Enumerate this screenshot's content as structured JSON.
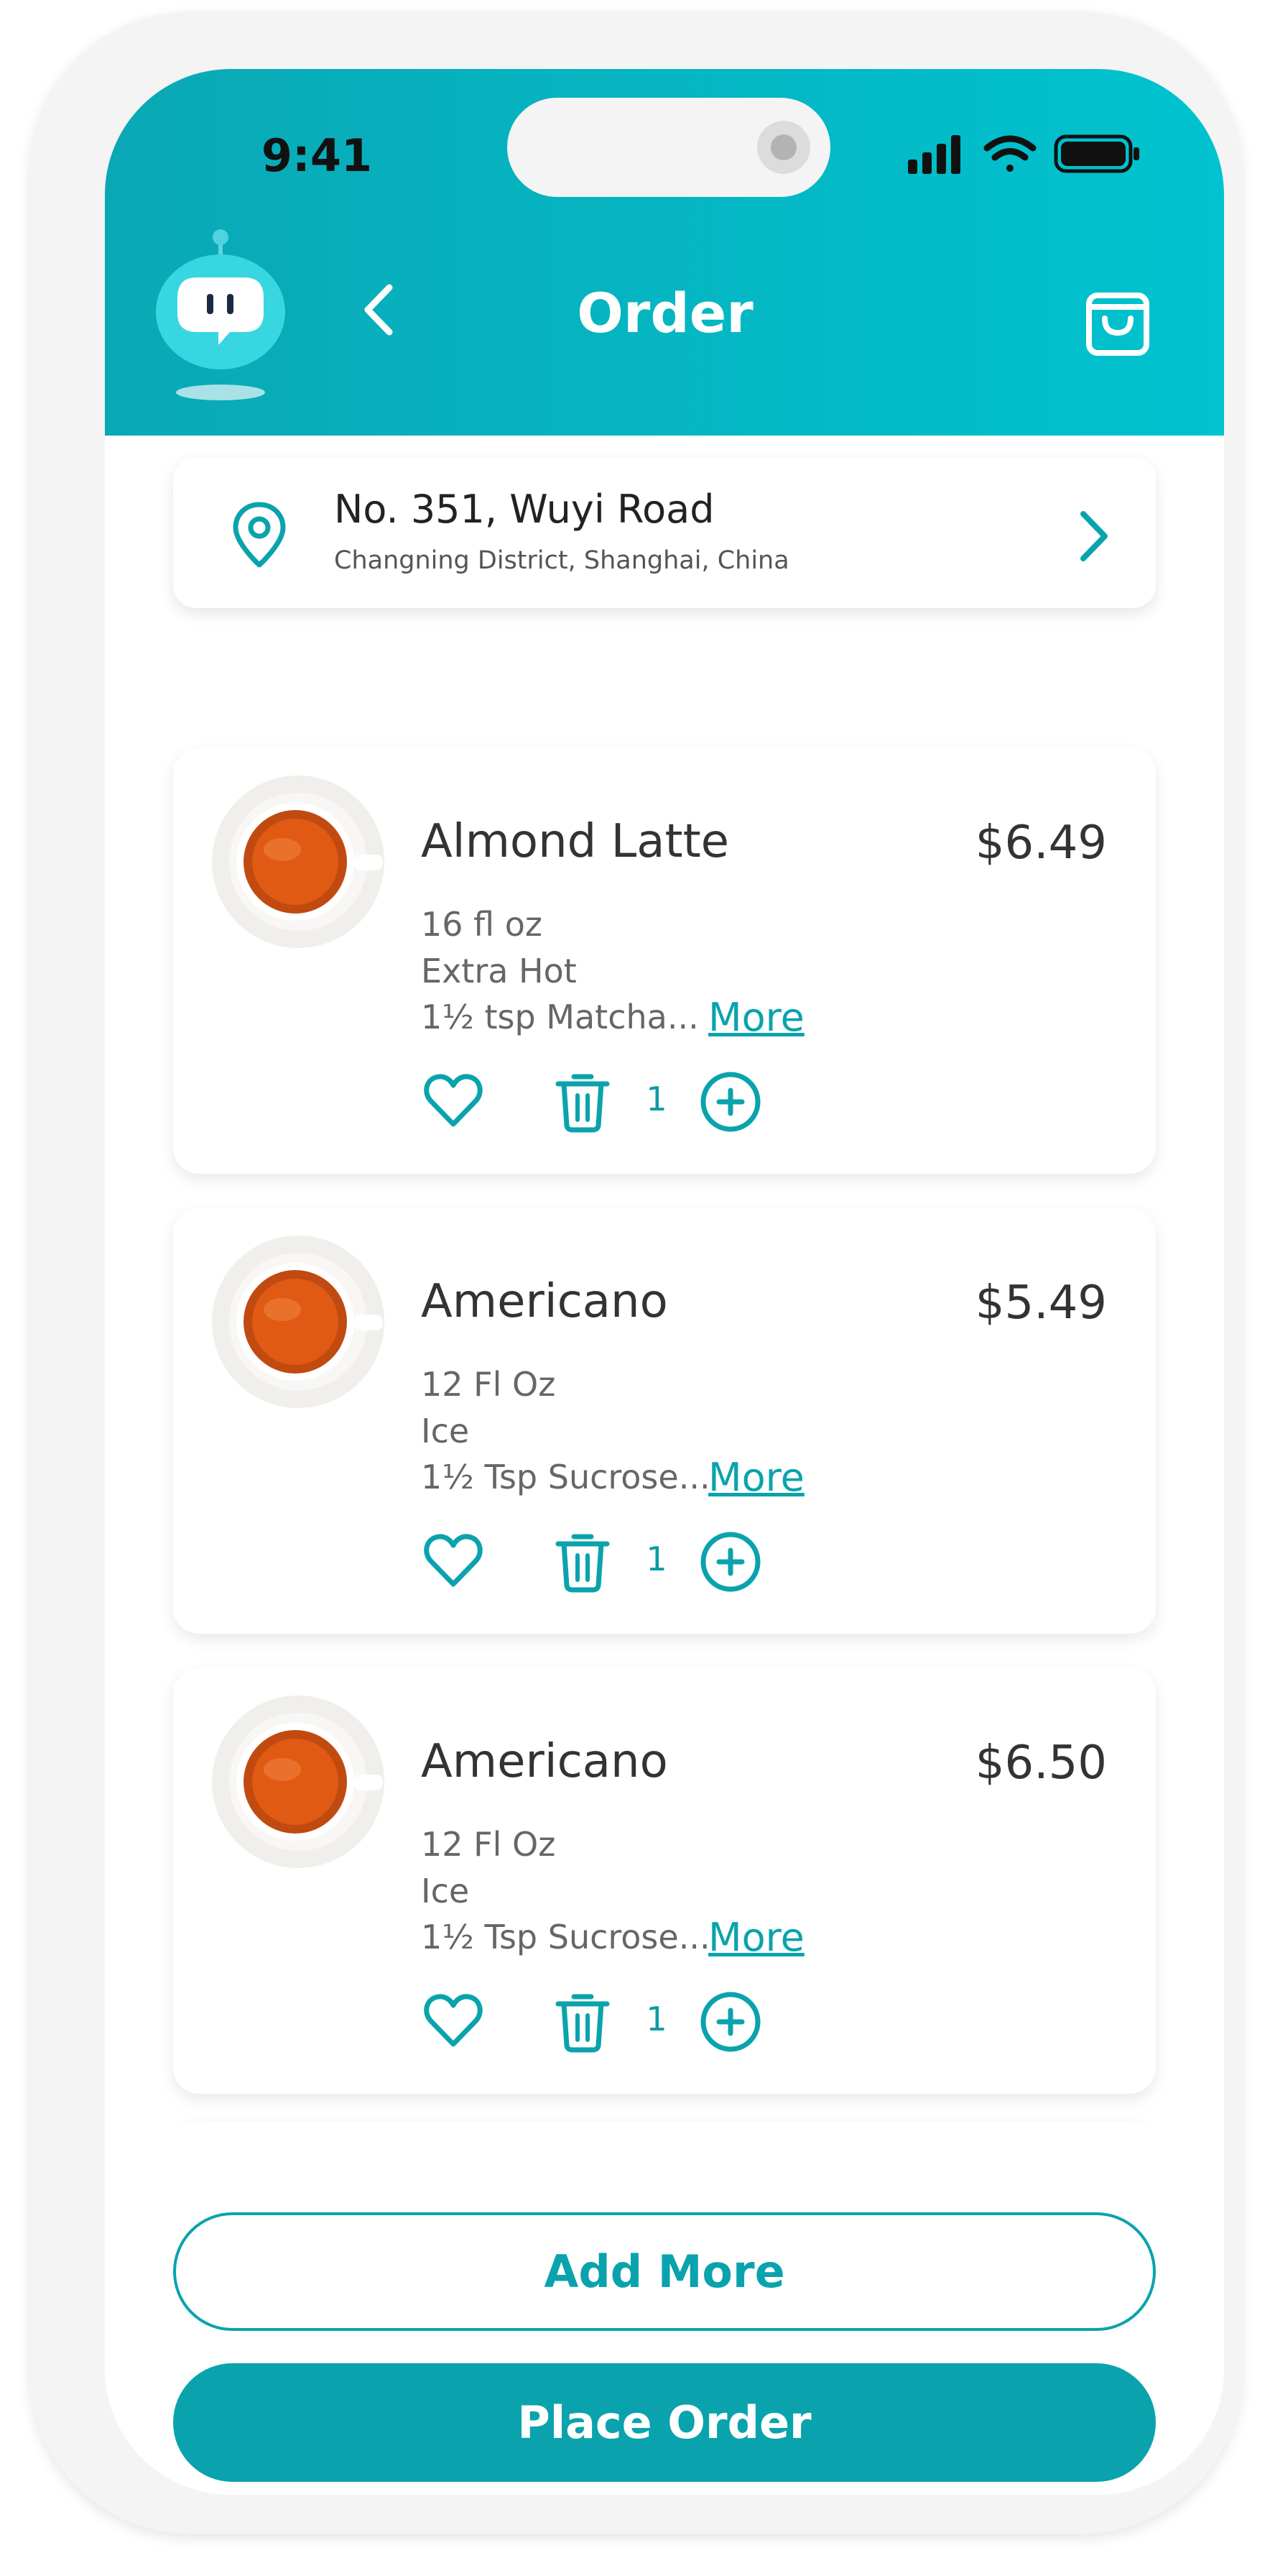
{
  "colors": {
    "accent": "#0aa3ad",
    "header_gradient_start": "#0aa8b5",
    "header_gradient_end": "#00c3cf",
    "text_primary": "#333333",
    "text_secondary": "#666666"
  },
  "status_bar": {
    "time": "9:41",
    "icons": [
      "signal-icon",
      "wifi-icon",
      "battery-icon"
    ]
  },
  "header": {
    "title": "Order",
    "icons": [
      "mascot-icon",
      "back-chevron-icon",
      "shopping-bag-icon"
    ]
  },
  "address": {
    "line1": "No. 351, Wuyi Road",
    "line2": "Changning District, Shanghai, China",
    "icons": [
      "location-pin-icon",
      "chevron-right-icon"
    ]
  },
  "order_items": [
    {
      "name": "Almond Latte",
      "price": "$6.49",
      "options": [
        "16 fl oz",
        "Extra Hot",
        "1½ tsp Matcha..."
      ],
      "more_label": "More",
      "quantity": "1"
    },
    {
      "name": "Americano",
      "price": "$5.49",
      "options": [
        "12 Fl Oz",
        "Ice",
        "1½ Tsp Sucrose..."
      ],
      "more_label": "More",
      "quantity": "1"
    },
    {
      "name": "Americano",
      "price": "$6.50",
      "options": [
        "12 Fl Oz",
        "Ice",
        "1½ Tsp Sucrose..."
      ],
      "more_label": "More",
      "quantity": "1"
    }
  ],
  "item_icons": [
    "coffee-cup-icon",
    "heart-icon",
    "trash-icon",
    "plus-circle-icon"
  ],
  "actions": {
    "add_more": "Add More",
    "place_order": "Place Order"
  }
}
